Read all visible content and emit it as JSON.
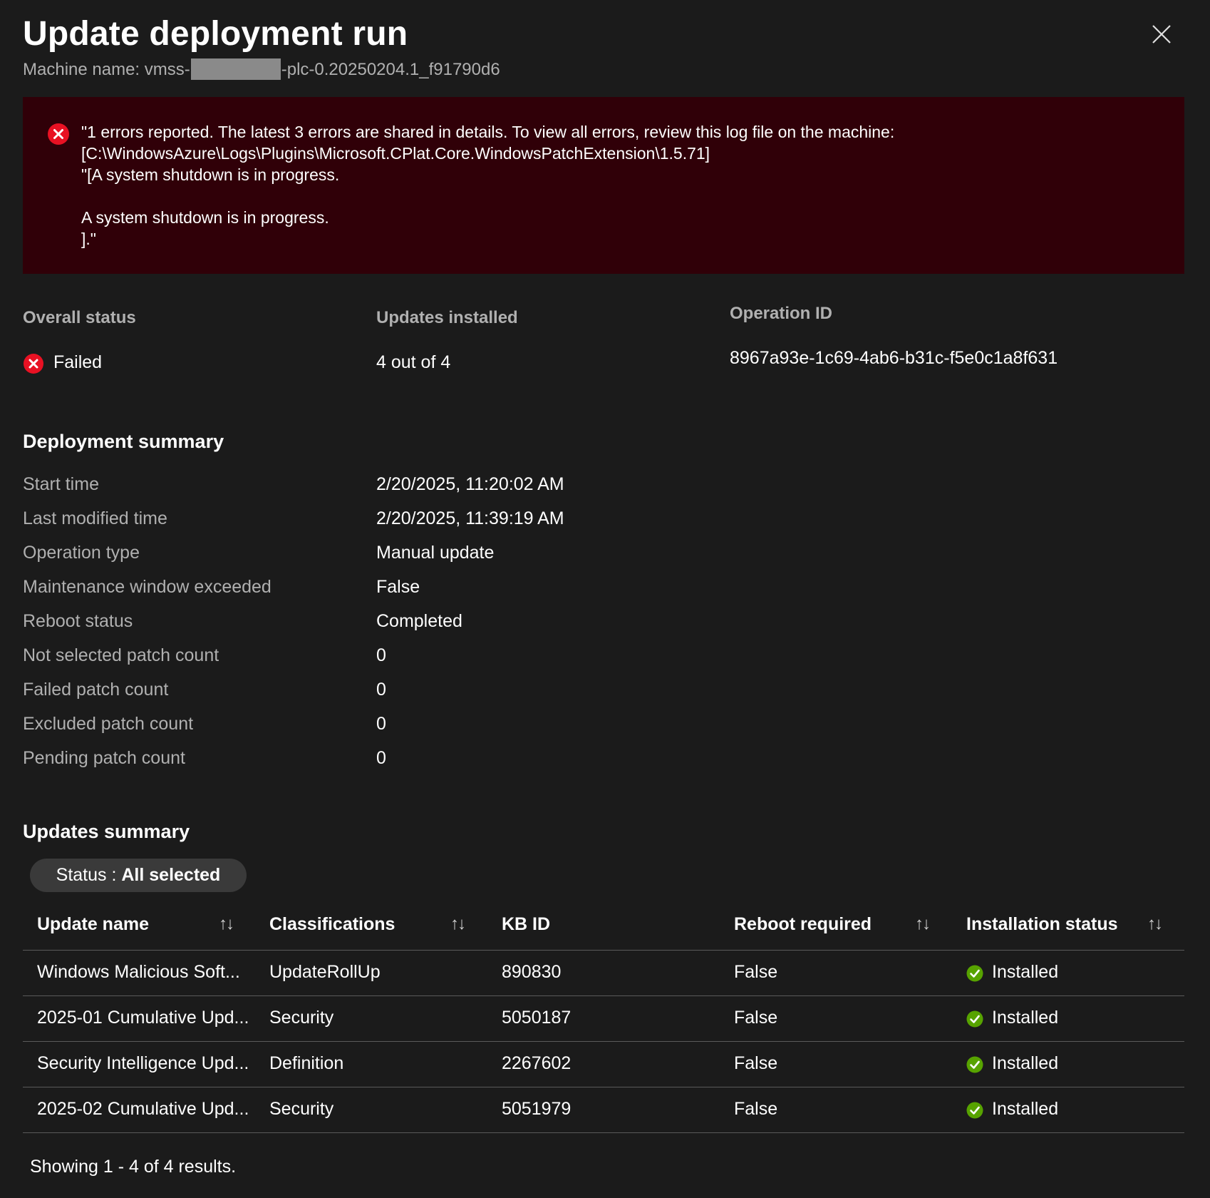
{
  "header": {
    "title": "Update deployment run",
    "machine_prefix": "Machine name: vmss-",
    "machine_suffix": "-plc-0.20250204.1_f91790d6"
  },
  "error": {
    "message": "\"1 errors reported. The latest 3 errors are shared in details. To view all errors, review this log file on the machine:\n[C:\\WindowsAzure\\Logs\\Plugins\\Microsoft.CPlat.Core.WindowsPatchExtension\\1.5.71]\n\"[A system shutdown is in progress.\n\nA system shutdown is in progress.\n].\""
  },
  "overview": {
    "overall_status_label": "Overall status",
    "overall_status_value": "Failed",
    "updates_installed_label": "Updates installed",
    "updates_installed_value": "4 out of 4",
    "operation_id_label": "Operation ID",
    "operation_id_value": "8967a93e-1c69-4ab6-b31c-f5e0c1a8f631"
  },
  "deployment_summary": {
    "title": "Deployment summary",
    "rows": [
      {
        "label": "Start time",
        "value": "2/20/2025, 11:20:02 AM"
      },
      {
        "label": "Last modified time",
        "value": "2/20/2025, 11:39:19 AM"
      },
      {
        "label": "Operation type",
        "value": "Manual update"
      },
      {
        "label": "Maintenance window exceeded",
        "value": "False"
      },
      {
        "label": "Reboot status",
        "value": "Completed"
      },
      {
        "label": "Not selected patch count",
        "value": "0"
      },
      {
        "label": "Failed patch count",
        "value": "0"
      },
      {
        "label": "Excluded patch count",
        "value": "0"
      },
      {
        "label": "Pending patch count",
        "value": "0"
      }
    ]
  },
  "updates_summary": {
    "title": "Updates summary",
    "filter_label": "Status : ",
    "filter_value": "All selected",
    "sort_glyph": "↑↓",
    "columns": [
      "Update name",
      "Classifications",
      "KB ID",
      "Reboot required",
      "Installation status"
    ],
    "rows": [
      {
        "name": "Windows Malicious Soft...",
        "classification": "UpdateRollUp",
        "kb": "890830",
        "reboot": "False",
        "status": "Installed"
      },
      {
        "name": "2025-01 Cumulative Upd...",
        "classification": "Security",
        "kb": "5050187",
        "reboot": "False",
        "status": "Installed"
      },
      {
        "name": "Security Intelligence Upd...",
        "classification": "Definition",
        "kb": "2267602",
        "reboot": "False",
        "status": "Installed"
      },
      {
        "name": "2025-02 Cumulative Upd...",
        "classification": "Security",
        "kb": "5051979",
        "reboot": "False",
        "status": "Installed"
      }
    ],
    "footer": "Showing 1 - 4 of 4 results."
  },
  "colors": {
    "background": "#1b1b1b",
    "error_background": "#300008",
    "error_icon": "#e81123",
    "success_icon": "#57a300"
  }
}
